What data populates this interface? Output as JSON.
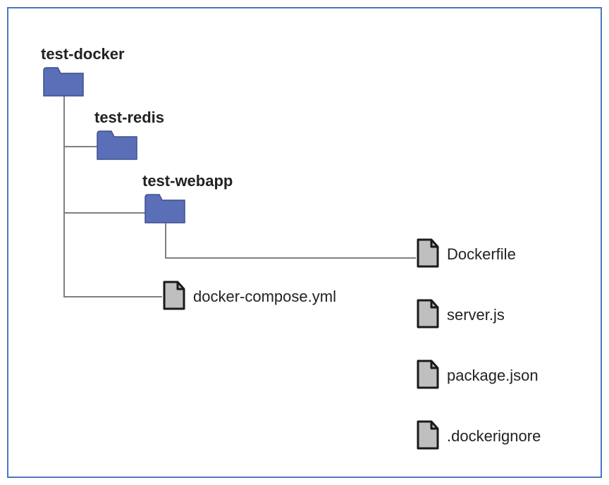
{
  "tree": {
    "root": {
      "label": "test-docker"
    },
    "child1": {
      "label": "test-redis"
    },
    "child2": {
      "label": "test-webapp"
    },
    "compose": {
      "label": "docker-compose.yml"
    },
    "files": [
      {
        "label": "Dockerfile"
      },
      {
        "label": "server.js"
      },
      {
        "label": "package.json"
      },
      {
        "label": ".dockerignore"
      }
    ]
  },
  "colors": {
    "folder": "#5b6fb8",
    "file_fill": "#bfbfbf",
    "file_stroke": "#1a1a1a",
    "connector": "#808080",
    "frame_border": "#4a77c4"
  }
}
